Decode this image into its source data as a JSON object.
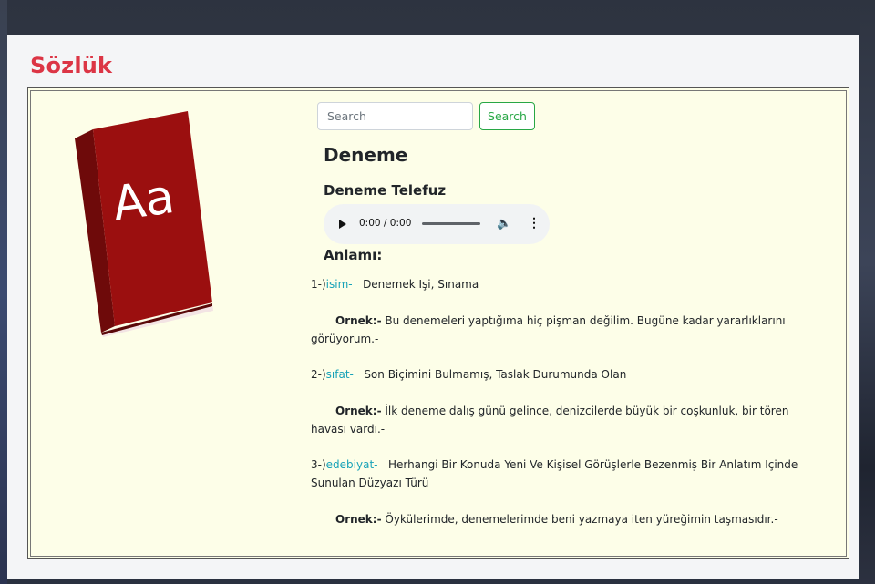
{
  "brand": "Sözlük",
  "search": {
    "placeholder": "Search",
    "button_label": "Search"
  },
  "book_icon": {
    "name": "dictionary-book-icon",
    "letters": "Aa",
    "color": "#9b0f0f"
  },
  "entry": {
    "word": "Deneme",
    "pronunciation_title": "Deneme Telefuz",
    "audio": {
      "time": "0:00 / 0:00"
    },
    "meaning_title": "Anlamı:",
    "definitions": [
      {
        "prefix": "1-)",
        "type": "isim-",
        "text": "Denemek Işi, Sınama",
        "example_label": "Ornek:-",
        "example": "Bu denemeleri yaptığıma hiç pişman değilim. Bugüne kadar yararlıklarını görüyorum.-"
      },
      {
        "prefix": "2-)",
        "type": "sıfat-",
        "text": "Son Biçimini Bulmamış, Taslak Durumunda Olan",
        "example_label": "Ornek:-",
        "example": "İlk deneme dalış günü gelince, denizcilerde büyük bir coşkunluk, bir tören havası vardı.-"
      },
      {
        "prefix": "3-)",
        "type": "edebiyat-",
        "text": "Herhangi Bir Konuda Yeni Ve Kişisel Görüşlerle Bezenmiş Bir Anlatım Içinde Sunulan Düzyazı Türü",
        "example_label": "Ornek:-",
        "example": "Öykülerimde, denemelerimde beni yazmaya iten yüreğimin taşmasıdır.-"
      }
    ]
  },
  "colors": {
    "brand": "#dc3545",
    "accent": "#17a2b8",
    "success": "#28a745",
    "panel_bg": "#fdfee8"
  }
}
